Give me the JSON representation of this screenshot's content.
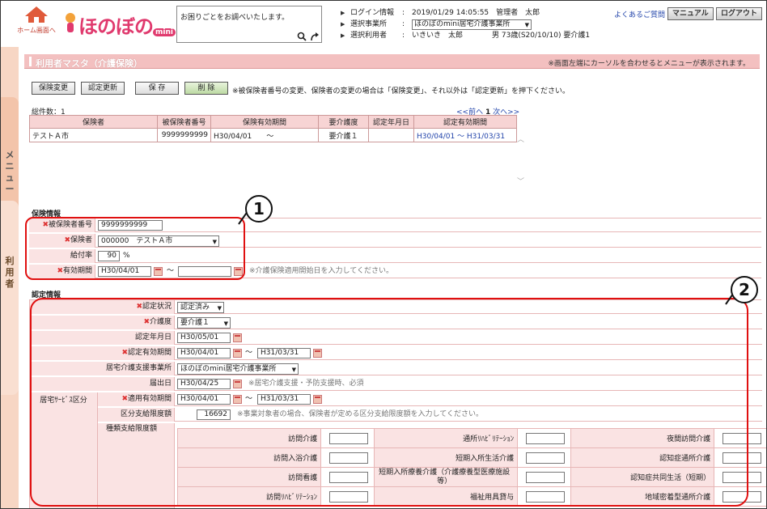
{
  "header": {
    "home_label": "ホーム画面へ",
    "logo_text": "ほのぼの",
    "logo_mini": "mini",
    "help_text": "お困りごとをお調べいたします。",
    "session": [
      {
        "label": "ログイン情報",
        "value": "2019/01/29 14:05:55　管理者　太郎"
      },
      {
        "label": "選択事業所",
        "value": "ほのぼのmini居宅介護事業所"
      },
      {
        "label": "選択利用者",
        "value": "いきいき　太郎　　　　男 73歳(S20/10/10) 要介護1"
      }
    ],
    "faq_label": "よくあるご質問",
    "manual_label": "マニュアル",
    "logout_label": "ログアウト"
  },
  "side": {
    "menu_label": [
      "メ",
      "ニ",
      "ュ",
      "ー"
    ],
    "user_label": [
      "利",
      "用",
      "者"
    ]
  },
  "title_bar": {
    "title": "利用者マスタ（介護保険）",
    "note": "※画面左端にカーソルを合わせるとメニューが表示されます。"
  },
  "actions": {
    "change": "保険変更",
    "renew": "認定更新",
    "save": "保 存",
    "delete": "削 除",
    "note": "※被保険者番号の変更、保険者の変更の場合は「保険変更」、それ以外は「認定更新」を押下ください。"
  },
  "list": {
    "total": "総件数：1",
    "pager_prev": "<<前へ",
    "pager_page": "1",
    "pager_next": "次へ>>",
    "headers": [
      "保険者",
      "被保険者番号",
      "保険有効期間",
      "要介護度",
      "認定年月日",
      "認定有効期間"
    ],
    "rows": [
      [
        "テストＡ市",
        "9999999999",
        "H30/04/01　　～",
        "要介護１",
        "",
        "H30/04/01 ～ H31/03/31"
      ]
    ]
  },
  "insurance": {
    "section_label": "保険情報",
    "insured_no_label": "被保険者番号",
    "insured_no": "9999999999",
    "insurer_label": "保険者",
    "insurer": "000000　テストＡ市",
    "benefit_label": "給付率",
    "benefit": "90",
    "benefit_unit": "%",
    "valid_label": "有効期間",
    "valid_from": "H30/04/01",
    "valid_to": "",
    "valid_note": "※介護保険適用開始日を入力してください。"
  },
  "cert": {
    "section_label": "認定情報",
    "status_label": "認定状況",
    "status": "認定済み",
    "level_label": "介護度",
    "level": "要介護１",
    "date_label": "認定年月日",
    "date": "H30/05/01",
    "valid_label": "認定有効期間",
    "valid_from": "H30/04/01",
    "valid_to": "H31/03/31",
    "office_label": "居宅介護支援事業所",
    "office": "ほのぼのmini居宅介護事業所",
    "notify_label": "届出日",
    "notify": "H30/04/25",
    "notify_note": "※居宅介護支援・予防支援時、必須",
    "svc_group_label": "居宅ｻｰﾋﾞｽ区分",
    "svc_valid_label": "適用有効期間",
    "svc_valid_from": "H30/04/01",
    "svc_valid_to": "H31/03/31",
    "limit_label": "区分支給限度額",
    "limit": "16692",
    "limit_note": "※事業対象者の場合、保険者が定める区分支給限度額を入力してください。",
    "kind_label": "種類支給限度額",
    "kinds": [
      [
        "訪問介護",
        "通所ﾘﾊﾋﾞﾘﾃｰｼｮﾝ",
        "夜間訪問介護"
      ],
      [
        "訪問入浴介護",
        "短期入所生活介護",
        "認知症通所介護"
      ],
      [
        "訪問看護",
        "短期入所療養介護（介護療養型医療施設等）",
        "認知症共同生活（短期）"
      ],
      [
        "訪問ﾘﾊﾋﾞﾘﾃｰｼｮﾝ",
        "福祉用具貸与",
        "地域密着型通所介護"
      ]
    ]
  },
  "annotations": {
    "callout1": "1",
    "callout2": "2"
  }
}
